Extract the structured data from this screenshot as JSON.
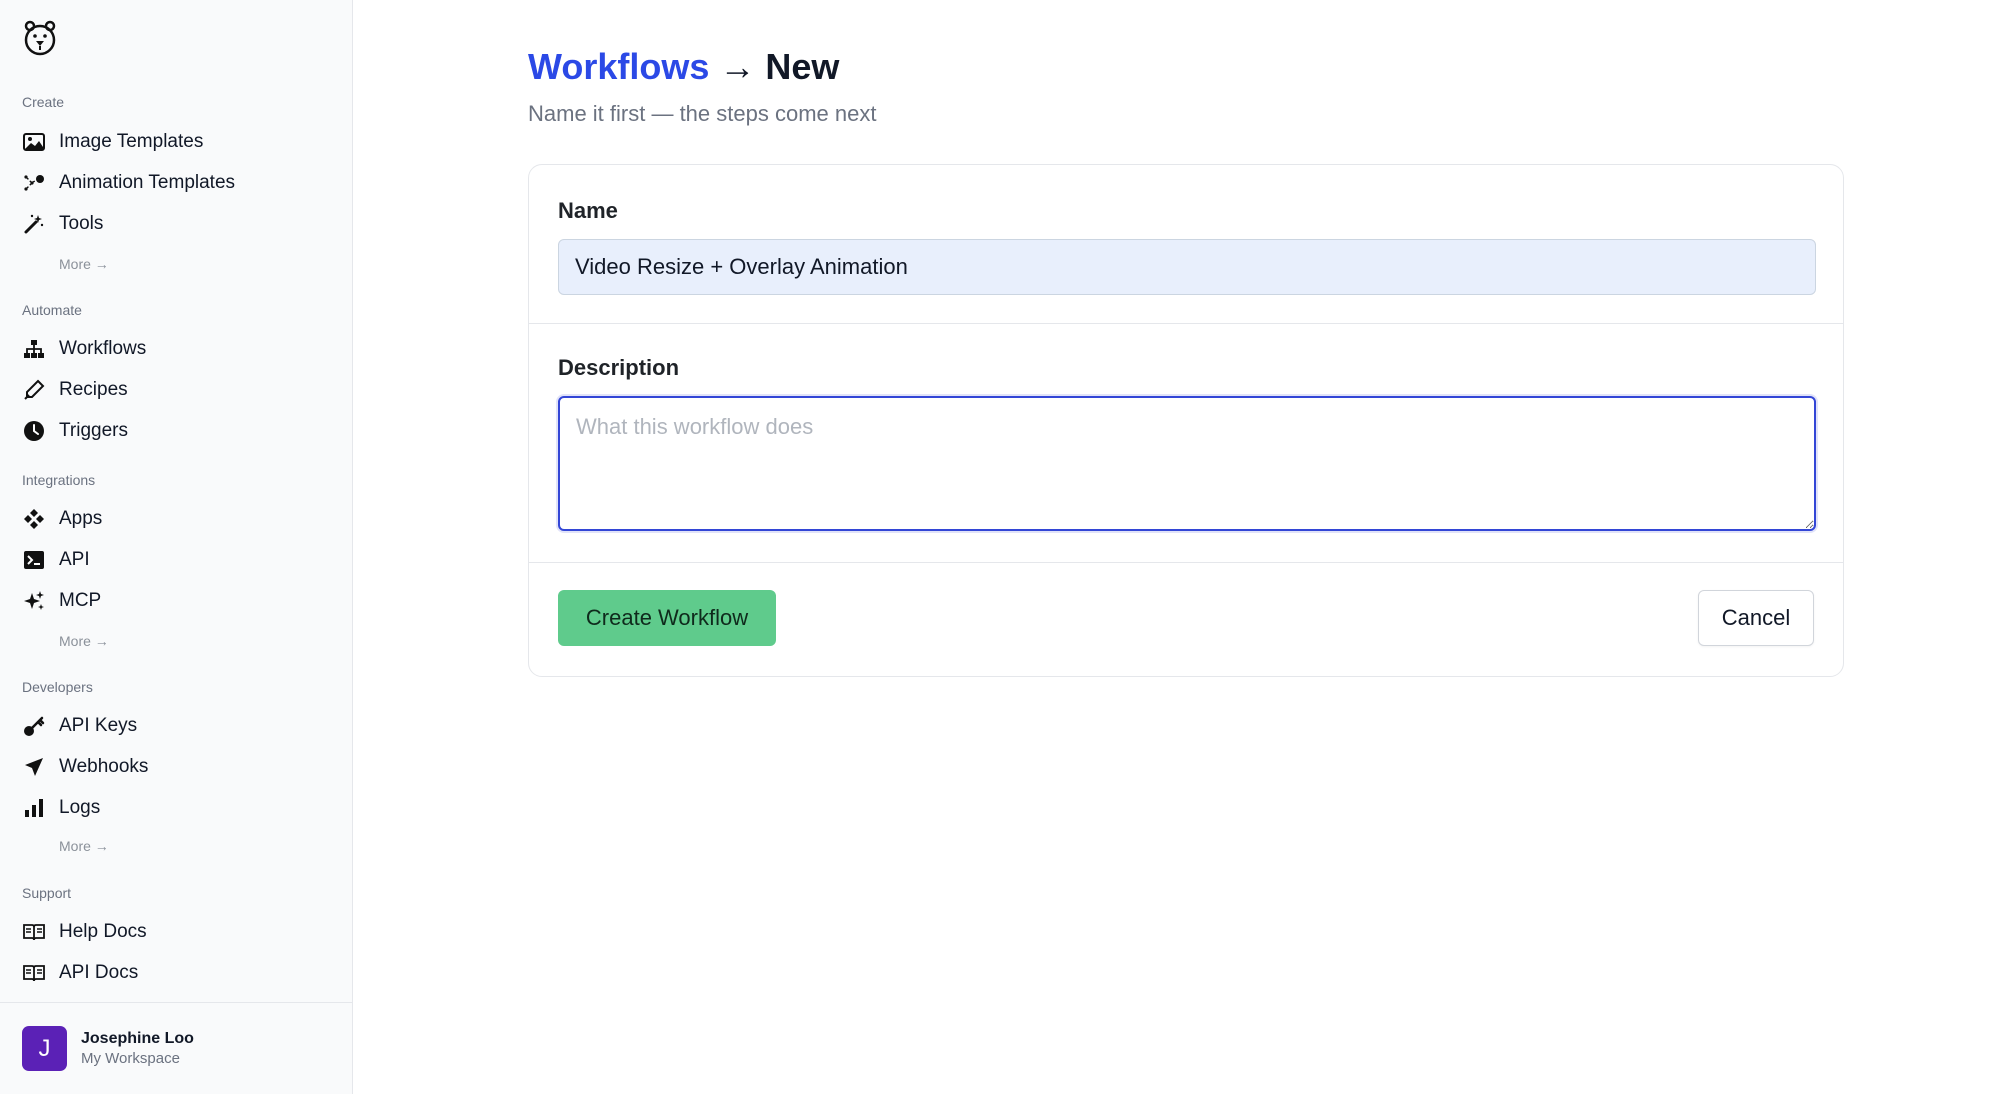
{
  "sidebar": {
    "sections": [
      {
        "title": "Create",
        "items": [
          {
            "label": "Image Templates",
            "icon": "image-icon"
          },
          {
            "label": "Animation Templates",
            "icon": "animation-icon"
          },
          {
            "label": "Tools",
            "icon": "magic-wand-icon"
          }
        ],
        "more": "More →"
      },
      {
        "title": "Automate",
        "items": [
          {
            "label": "Workflows",
            "icon": "sitemap-icon"
          },
          {
            "label": "Recipes",
            "icon": "pen-icon"
          },
          {
            "label": "Triggers",
            "icon": "clock-icon"
          }
        ]
      },
      {
        "title": "Integrations",
        "items": [
          {
            "label": "Apps",
            "icon": "apps-icon"
          },
          {
            "label": "API",
            "icon": "terminal-icon"
          },
          {
            "label": "MCP",
            "icon": "sparkle-icon"
          }
        ],
        "more": "More →"
      },
      {
        "title": "Developers",
        "items": [
          {
            "label": "API Keys",
            "icon": "key-icon"
          },
          {
            "label": "Webhooks",
            "icon": "paper-plane-icon"
          },
          {
            "label": "Logs",
            "icon": "bar-chart-icon"
          }
        ],
        "more": "More →"
      },
      {
        "title": "Support",
        "items": [
          {
            "label": "Help Docs",
            "icon": "book-icon"
          },
          {
            "label": "API Docs",
            "icon": "book-icon"
          }
        ]
      }
    ],
    "user": {
      "initial": "J",
      "name": "Josephine Loo",
      "workspace": "My Workspace"
    }
  },
  "page": {
    "breadcrumb_link": "Workflows",
    "breadcrumb_arrow": "→",
    "breadcrumb_current": "New",
    "subtitle": "Name it first — the steps come next"
  },
  "form": {
    "name_label": "Name",
    "name_value": "Video Resize + Overlay Animation",
    "description_label": "Description",
    "description_placeholder": "What this workflow does",
    "description_value": "",
    "create_label": "Create Workflow",
    "cancel_label": "Cancel"
  },
  "colors": {
    "accent_link": "#2b49e6",
    "create_button": "#5fcb8c",
    "avatar": "#5b21b6",
    "focus_ring": "#3346d6"
  }
}
